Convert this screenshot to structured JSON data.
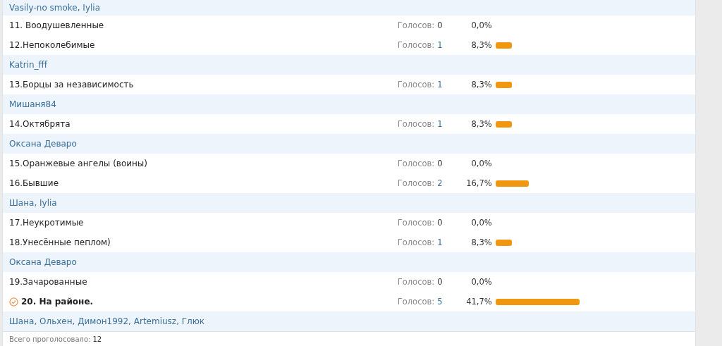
{
  "rows": [
    {
      "kind": "voters",
      "text": "Vasily-no smoke, Iylia"
    },
    {
      "kind": "option",
      "label": "11. Воодушевленные",
      "votes_label": "Голосов:",
      "count": "0",
      "percent": "0,0%",
      "chosen": false
    },
    {
      "kind": "option",
      "label": "12.Непоколебимые",
      "votes_label": "Голосов:",
      "count": "1",
      "percent": "8,3%",
      "chosen": false
    },
    {
      "kind": "voters",
      "text": "Katrin_fff"
    },
    {
      "kind": "option",
      "label": "13.Борцы за независимость",
      "votes_label": "Голосов:",
      "count": "1",
      "percent": "8,3%",
      "chosen": false
    },
    {
      "kind": "voters",
      "text": "Мишаня84"
    },
    {
      "kind": "option",
      "label": "14.Октябрята",
      "votes_label": "Голосов:",
      "count": "1",
      "percent": "8,3%",
      "chosen": false
    },
    {
      "kind": "voters",
      "text": "Оксана Деваро"
    },
    {
      "kind": "option",
      "label": "15.Оранжевые ангелы (воины)",
      "votes_label": "Голосов:",
      "count": "0",
      "percent": "0,0%",
      "chosen": false
    },
    {
      "kind": "option",
      "label": "16.Бывшие",
      "votes_label": "Голосов:",
      "count": "2",
      "percent": "16,7%",
      "chosen": false
    },
    {
      "kind": "voters",
      "text": "Шана, Iylia"
    },
    {
      "kind": "option",
      "label": "17.Неукротимые",
      "votes_label": "Голосов:",
      "count": "0",
      "percent": "0,0%",
      "chosen": false
    },
    {
      "kind": "option",
      "label": "18.Унесённые пеплом)",
      "votes_label": "Голосов:",
      "count": "1",
      "percent": "8,3%",
      "chosen": false
    },
    {
      "kind": "voters",
      "text": "Оксана Деваро"
    },
    {
      "kind": "option",
      "label": "19.Зачарованные",
      "votes_label": "Голосов:",
      "count": "0",
      "percent": "0,0%",
      "chosen": false
    },
    {
      "kind": "option",
      "label": "20. На районе.",
      "votes_label": "Голосов:",
      "count": "5",
      "percent": "41,7%",
      "chosen": true
    },
    {
      "kind": "voters",
      "text": "Шана, Ольхен, Димон1992, Artemiusz, Глюк"
    }
  ],
  "footer": {
    "label": "Всего проголосовало:",
    "count": "12"
  }
}
